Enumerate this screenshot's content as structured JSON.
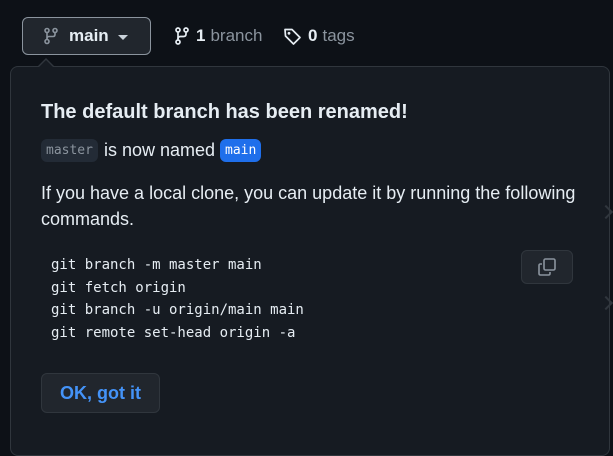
{
  "branch_selector": {
    "current_branch": "main",
    "icon": "git-branch-icon",
    "caret_icon": "triangle-down-icon"
  },
  "branches_link": {
    "count": "1",
    "label": "branch",
    "icon": "git-branch-icon"
  },
  "tags_link": {
    "count": "0",
    "label": "tags",
    "icon": "tag-icon"
  },
  "popover": {
    "title": "The default branch has been renamed!",
    "old_branch": "master",
    "renamed_text": "is now named",
    "new_branch": "main",
    "instructions": "If you have a local clone, you can update it by running the following commands.",
    "commands": [
      "git branch -m master main",
      "git fetch origin",
      "git branch -u origin/main main",
      "git remote set-head origin -a"
    ],
    "copy_icon": "copy-icon",
    "ok_button": "OK, got it"
  },
  "colors": {
    "background": "#0d1117",
    "popover_bg": "#161b22",
    "border": "#30363d",
    "accent_blue": "#1f6feb",
    "link_blue": "#4493f8",
    "muted_text": "#8b949e",
    "text": "#e6edf3"
  }
}
